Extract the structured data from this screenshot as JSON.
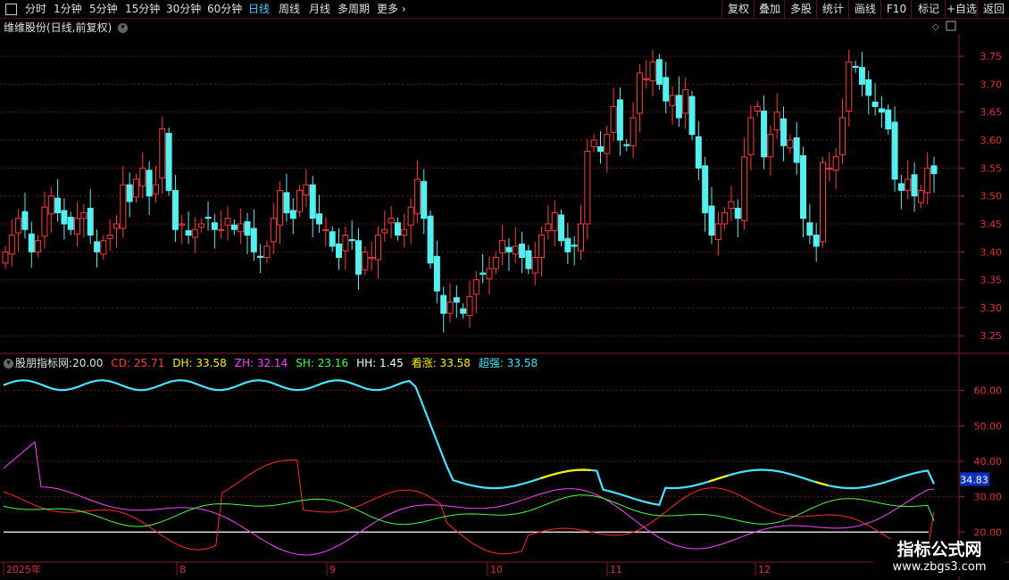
{
  "toolbar": {
    "periods": [
      {
        "label": "分时",
        "active": false
      },
      {
        "label": "1分钟",
        "active": false
      },
      {
        "label": "5分钟",
        "active": false
      },
      {
        "label": "15分钟",
        "active": false
      },
      {
        "label": "30分钟",
        "active": false
      },
      {
        "label": "60分钟",
        "active": false
      },
      {
        "label": "日线",
        "active": true
      },
      {
        "label": "周线",
        "active": false
      },
      {
        "label": "月线",
        "active": false
      },
      {
        "label": "多周期",
        "active": false
      },
      {
        "label": "更多",
        "active": false
      }
    ],
    "right_buttons": [
      "复权",
      "叠加",
      "多股",
      "统计",
      "画线",
      "F10",
      "标记",
      "+自选",
      "返回"
    ]
  },
  "main_chart": {
    "title": "维维股份(日线,前复权)",
    "y_ticks": [
      "3.75",
      "3.70",
      "3.65",
      "3.60",
      "3.55",
      "3.50",
      "3.45",
      "3.40",
      "3.35",
      "3.30",
      "3.25"
    ],
    "colors": {
      "up": "#ff3b3b",
      "down": "#54f0f0",
      "grid": "#7a1a1a"
    }
  },
  "indicator": {
    "name": "股朋指标网",
    "baseline_value": "20.00",
    "items": [
      {
        "label": "CD:",
        "value": "25.71",
        "color": "#ff3b3b"
      },
      {
        "label": "DH:",
        "value": "33.58",
        "color": "#ffee00"
      },
      {
        "label": "ZH:",
        "value": "32.14",
        "color": "#ff44ff"
      },
      {
        "label": "SH:",
        "value": "23.16",
        "color": "#44ff44"
      },
      {
        "label": "HH:",
        "value": "1.45",
        "color": "#ffffff"
      },
      {
        "label": "看涨:",
        "value": "33.58",
        "color": "#ffee00"
      },
      {
        "label": "超强:",
        "value": "33.58",
        "color": "#44e5ff"
      }
    ],
    "y_ticks": [
      "60.00",
      "50.00",
      "40.00",
      "30.00",
      "20.00"
    ],
    "current_badge": "34.83"
  },
  "x_axis": {
    "labels": [
      "2025年",
      "8",
      "9",
      "10",
      "11",
      "12"
    ]
  },
  "watermark": {
    "line1": "指标公式网",
    "line2": "www.zbgs3.com"
  },
  "chart_data": [
    {
      "type": "candlestick",
      "title": "维维股份(日线,前复权)",
      "y_ticks": [
        3.25,
        3.3,
        3.35,
        3.4,
        3.45,
        3.5,
        3.55,
        3.6,
        3.65,
        3.7,
        3.75
      ],
      "ylim": [
        3.22,
        3.79
      ],
      "x_labels": [
        "2025年",
        "8",
        "9",
        "10",
        "11",
        "12"
      ],
      "closes": [
        3.4,
        3.43,
        3.46,
        3.44,
        3.4,
        3.42,
        3.48,
        3.5,
        3.47,
        3.45,
        3.44,
        3.46,
        3.47,
        3.43,
        3.4,
        3.42,
        3.43,
        3.45,
        3.52,
        3.49,
        3.53,
        3.55,
        3.5,
        3.52,
        3.62,
        3.51,
        3.44,
        3.45,
        3.43,
        3.44,
        3.45,
        3.46,
        3.44,
        3.44,
        3.46,
        3.44,
        3.45,
        3.43,
        3.4,
        3.39,
        3.41,
        3.46,
        3.51,
        3.47,
        3.46,
        3.51,
        3.52,
        3.46,
        3.45,
        3.44,
        3.41,
        3.39,
        3.43,
        3.42,
        3.36,
        3.4,
        3.39,
        3.43,
        3.44,
        3.46,
        3.43,
        3.44,
        3.48,
        3.53,
        3.46,
        3.38,
        3.33,
        3.29,
        3.31,
        3.31,
        3.29,
        3.32,
        3.35,
        3.36,
        3.37,
        3.39,
        3.42,
        3.4,
        3.41,
        3.39,
        3.37,
        3.39,
        3.43,
        3.45,
        3.47,
        3.42,
        3.4,
        3.41,
        3.45,
        3.58,
        3.6,
        3.58,
        3.61,
        3.66,
        3.6,
        3.59,
        3.64,
        3.72,
        3.71,
        3.74,
        3.7,
        3.67,
        3.68,
        3.64,
        3.69,
        3.61,
        3.55,
        3.47,
        3.43,
        3.45,
        3.47,
        3.49,
        3.46,
        3.57,
        3.64,
        3.66,
        3.57,
        3.61,
        3.65,
        3.59,
        3.6,
        3.56,
        3.46,
        3.43,
        3.41,
        3.56,
        3.55,
        3.57,
        3.64,
        3.74,
        3.73,
        3.7,
        3.68,
        3.66,
        3.65,
        3.62,
        3.53,
        3.51,
        3.53,
        3.5,
        3.51,
        3.55,
        3.54
      ]
    },
    {
      "type": "line",
      "title": "股朋指标网",
      "y_ticks": [
        20,
        30,
        40,
        50,
        60
      ],
      "ylim": [
        12,
        70
      ],
      "baseline": 20.0,
      "series": [
        {
          "name": "超强",
          "last": 33.58
        },
        {
          "name": "CD",
          "last": 25.71
        },
        {
          "name": "DH",
          "last": 33.58
        },
        {
          "name": "ZH",
          "last": 32.14
        },
        {
          "name": "SH",
          "last": 23.16
        },
        {
          "name": "HH",
          "last": 1.45
        },
        {
          "name": "看涨",
          "last": 33.58
        }
      ]
    }
  ]
}
